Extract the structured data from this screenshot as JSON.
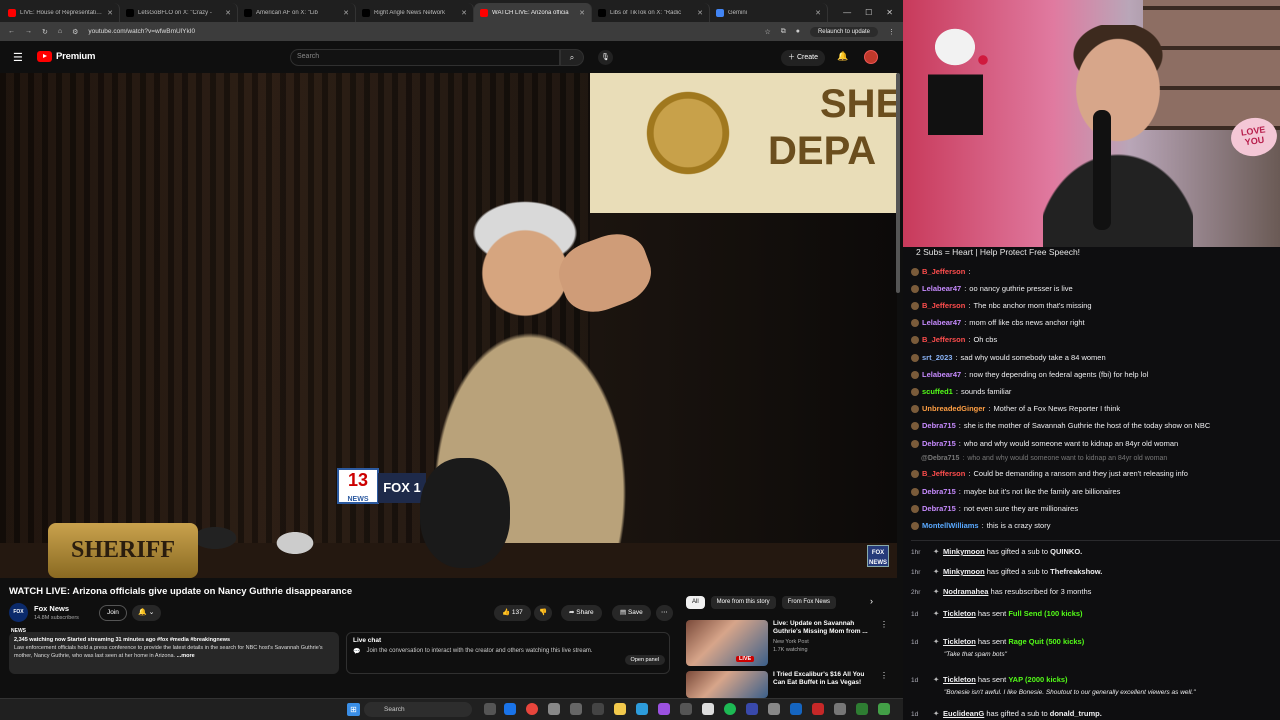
{
  "browser": {
    "tabs": [
      {
        "label": "LIVE: House of Representatives",
        "color": "#ff0000",
        "active": false
      },
      {
        "label": "LetsGoBFLO on X: \"Crazy -",
        "color": "#000000",
        "active": false
      },
      {
        "label": "American AF on X: \"Lib",
        "color": "#000000",
        "active": false
      },
      {
        "label": "Right Angle News Network",
        "color": "#000000",
        "active": false
      },
      {
        "label": "WATCH LIVE: Arizona officia",
        "color": "#ff0000",
        "active": true
      },
      {
        "label": "Libs of TikTok on X: \"Radic",
        "color": "#000000",
        "active": false
      },
      {
        "label": "Gemini",
        "color": "#4285f4",
        "active": false
      }
    ],
    "url": "youtube.com/watch?v=wfwBmUlYkI0",
    "relaunch": "Relaunch to update"
  },
  "youtube": {
    "logo_text": "Premium",
    "search_placeholder": "Search",
    "create_label": "Create",
    "video": {
      "title": "WATCH LIVE: Arizona officials give update on Nancy Guthrie disappearance",
      "seal_line1": "SHE",
      "seal_line2": "DEPA",
      "mic_13": "13",
      "mic_13_sub": "NEWS",
      "mic_fox": "FOX 1",
      "sheriff_sign": "SHERIFF",
      "fox_bug": "FOX NEWS"
    },
    "channel": {
      "avatar_text": "FOX NEWS",
      "name": "Fox News",
      "subscribers": "14.8M subscribers",
      "join_label": "Join"
    },
    "actions": {
      "likes": "137",
      "share": "Share",
      "save": "Save"
    },
    "description": {
      "meta": "2,345 watching now  Started streaming 31 minutes ago  #fox #media #breakingnews",
      "body": "Law enforcement officials hold a press conference to provide the latest details in the search for NBC host's Savannah Guthrie's mother, Nancy Guthrie, who was last seen at her home in Arizona.",
      "more": "...more"
    },
    "livechat": {
      "title": "Live chat",
      "text": "Join the conversation to interact with the creator and others watching this live stream.",
      "open_panel": "Open panel"
    },
    "chips": [
      "All",
      "More from this story",
      "From Fox News"
    ],
    "recommendations": [
      {
        "title": "Live: Update on Savannah Guthrie's Missing Mom from ...",
        "channel": "New York Post",
        "views": "1.7K watching",
        "badge": "LIVE"
      },
      {
        "title": "I Tried Excalibur's $16 All You Can Eat Buffet in Las Vegas!",
        "channel": "",
        "views": "",
        "badge": ""
      }
    ]
  },
  "taskbar": {
    "search_placeholder": "Search"
  },
  "webcam": {
    "sign": "LOVE YOU"
  },
  "chat": {
    "banner": "2 Subs = Heart | Help Protect Free Speech!",
    "messages": [
      {
        "user": "B_Jefferson",
        "text": "",
        "color": "#ff4d4d"
      },
      {
        "user": "Lelabear47",
        "text": "oo nancy guthrie presser is live",
        "color": "#c78bff"
      },
      {
        "user": "B_Jefferson",
        "text": "The nbc anchor mom that's missing",
        "color": "#ff4d4d"
      },
      {
        "user": "Lelabear47",
        "text": "mom off like cbs news anchor right",
        "color": "#c78bff"
      },
      {
        "user": "B_Jefferson",
        "text": "Oh cbs",
        "color": "#ff4d4d"
      },
      {
        "user": "srt_2023",
        "text": "sad why would somebody take a 84 women",
        "color": "#8ab4f8"
      },
      {
        "user": "Lelabear47",
        "text": "now they depending on federal agents (fbi) for help lol",
        "color": "#c78bff"
      },
      {
        "user": "scuffed1",
        "text": "sounds familiar",
        "color": "#53fc18"
      },
      {
        "user": "UnbreadedGinger",
        "text": "Mother of a Fox News Reporter I think",
        "color": "#ff9f43"
      },
      {
        "user": "Debra715",
        "text": "she is the mother of Savannah Guthrie the host of the today show on NBC",
        "color": "#c78bff"
      },
      {
        "user": "Debra715",
        "text": "who and why would someone want to kidnap an 84yr old woman",
        "color": "#c78bff"
      },
      {
        "user": "@Debra715",
        "text": "who and why would someone want to kidnap an 84yr old woman",
        "color": "#777777"
      },
      {
        "user": "B_Jefferson",
        "text": "Could be demanding a ransom and they just aren't releasing info",
        "color": "#ff4d4d"
      },
      {
        "user": "Debra715",
        "text": "maybe but it's not like the family are billionaires",
        "color": "#c78bff"
      },
      {
        "user": "Debra715",
        "text": "not even sure they are millionaires",
        "color": "#c78bff"
      },
      {
        "user": "MontellWilliams",
        "text": "this is a crazy story",
        "color": "#5aa9ff"
      }
    ],
    "events": [
      {
        "time": "1hr",
        "user": "Minkymoon",
        "text": "has gifted a sub to",
        "target": "QUINKO."
      },
      {
        "time": "1hr",
        "user": "Minkymoon",
        "text": "has gifted a sub to",
        "target": "Thefreakshow."
      },
      {
        "time": "2hr",
        "user": "Nodramahea",
        "text": "has resubscribed for 3 months",
        "target": ""
      },
      {
        "time": "1d",
        "user": "Tickleton",
        "text": "has sent",
        "target": "Full Send (100 kicks)",
        "quote": ""
      },
      {
        "time": "1d",
        "user": "Tickleton",
        "text": "has sent",
        "target": "Rage Quit (500 kicks)",
        "quote": "\"Take that spam bots\""
      },
      {
        "time": "1d",
        "user": "Tickleton",
        "text": "has sent",
        "target": "YAP (2000 kicks)",
        "quote": "\"Bonesie isn't awful. I like Bonesie. Shoutout to our generally excellent viewers as well.\""
      },
      {
        "time": "1d",
        "user": "EuclideanG",
        "text": "has gifted a sub to",
        "target": "donald_trump."
      }
    ]
  }
}
